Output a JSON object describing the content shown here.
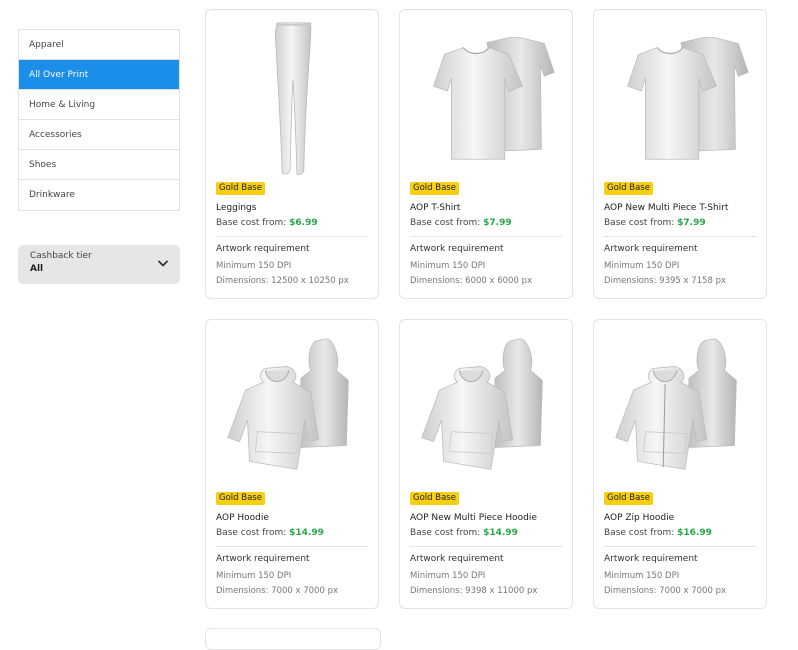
{
  "sidebar": {
    "categories": [
      {
        "label": "Apparel",
        "active": false
      },
      {
        "label": "All Over Print",
        "active": true
      },
      {
        "label": "Home & Living",
        "active": false
      },
      {
        "label": "Accessories",
        "active": false
      },
      {
        "label": "Shoes",
        "active": false
      },
      {
        "label": "Drinkware",
        "active": false
      }
    ],
    "cashback": {
      "label": "Cashback tier",
      "value": "All",
      "icon": "chevron-down-icon"
    }
  },
  "common": {
    "base_cost_label": "Base cost from: ",
    "artwork_title": "Artwork requirement"
  },
  "products": [
    {
      "badge": "Gold Base",
      "name": "Leggings",
      "price": "$6.99",
      "dpi": "Minimum 150 DPI",
      "dimensions": "Dimensions: 12500 x 10250 px",
      "image": "leggings-image"
    },
    {
      "badge": "Gold Base",
      "name": "AOP T-Shirt",
      "price": "$7.99",
      "dpi": "Minimum 150 DPI",
      "dimensions": "Dimensions: 6000 x 6000 px",
      "image": "tshirt-image"
    },
    {
      "badge": "Gold Base",
      "name": "AOP New Multi Piece T-Shirt",
      "price": "$7.99",
      "dpi": "Minimum 150 DPI",
      "dimensions": "Dimensions: 9395 x 7158 px",
      "image": "tshirt-image"
    },
    {
      "badge": "Gold Base",
      "name": "AOP Hoodie",
      "price": "$14.99",
      "dpi": "Minimum 150 DPI",
      "dimensions": "Dimensions: 7000 x 7000 px",
      "image": "hoodie-image"
    },
    {
      "badge": "Gold Base",
      "name": "AOP New Multi Piece Hoodie",
      "price": "$14.99",
      "dpi": "Minimum 150 DPI",
      "dimensions": "Dimensions: 9398 x 11000 px",
      "image": "hoodie-image"
    },
    {
      "badge": "Gold Base",
      "name": "AOP Zip Hoodie",
      "price": "$16.99",
      "dpi": "Minimum 150 DPI",
      "dimensions": "Dimensions: 7000 x 7000 px",
      "image": "zip-hoodie-image"
    }
  ]
}
